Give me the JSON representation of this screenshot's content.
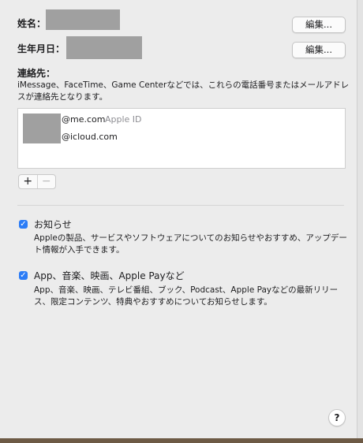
{
  "name_row": {
    "label": "姓名：",
    "edit_label": "編集..."
  },
  "birthday_row": {
    "label": "生年月日：",
    "edit_label": "編集..."
  },
  "contact": {
    "label": "連絡先：",
    "description_line1": "iMessage、FaceTime、Game Centerなどでは、これらの電話番号またはメールアドレ",
    "description_line2": "スが連絡先となります。",
    "emails": [
      {
        "address": "@me.com",
        "tag": "Apple ID"
      },
      {
        "address": "@icloud.com",
        "tag": ""
      }
    ],
    "add_symbol": "+",
    "remove_symbol": "−"
  },
  "news": {
    "checked": true,
    "check_mark": "✓",
    "title": "お知らせ",
    "description_line1": "Appleの製品、サービスやソフトウェアについてのお知らせやおすすめ、アップデー",
    "description_line2": "ト情報が入手できます。"
  },
  "media": {
    "checked": true,
    "check_mark": "✓",
    "title": "App、音楽、映画、Apple Payなど",
    "description_line1": "App、音楽、映画、テレビ番組、ブック、Podcast、Apple Payなどの最新リリー",
    "description_line2": "ス、限定コンテンツ、特典やおすすめについてお知らせします。"
  },
  "help": {
    "symbol": "?"
  },
  "colors": {
    "accent": "#2b7cf6",
    "background": "#ececec",
    "redaction": "#a0a0a0"
  }
}
